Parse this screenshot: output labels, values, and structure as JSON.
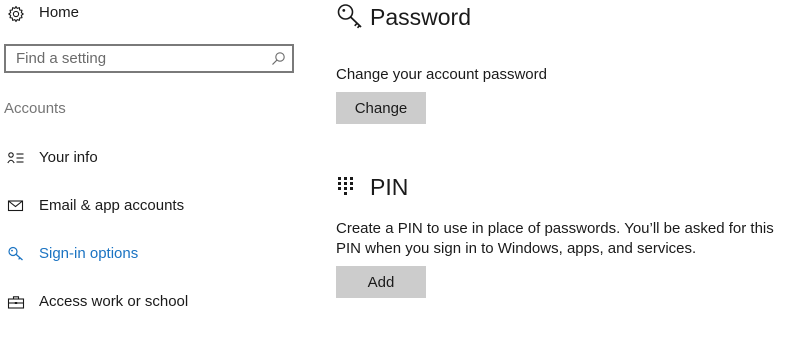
{
  "sidebar": {
    "home": {
      "label": "Home",
      "icon": "gear-icon"
    },
    "search": {
      "placeholder": "Find a setting",
      "value": "",
      "icon": "search-icon"
    },
    "section_title": "Accounts",
    "items": [
      {
        "label": "Your info",
        "icon": "person-card-icon",
        "active": false
      },
      {
        "label": "Email & app accounts",
        "icon": "mail-icon",
        "active": false
      },
      {
        "label": "Sign-in options",
        "icon": "key-icon",
        "active": true
      },
      {
        "label": "Access work or school",
        "icon": "briefcase-icon",
        "active": false
      }
    ]
  },
  "main": {
    "password": {
      "title": "Password",
      "icon": "key-icon",
      "description": "Change your account password",
      "button_label": "Change"
    },
    "pin": {
      "title": "PIN",
      "icon": "dialpad-icon",
      "description_line1": "Create a PIN to use in place of passwords. You’ll be asked for this",
      "description_line2": "PIN when you sign in to Windows, apps, and services.",
      "button_label": "Add"
    }
  },
  "colors": {
    "accent": "#1a73c2",
    "button_bg": "#cccccc",
    "section_title": "#767676",
    "text": "#1a1a1a"
  }
}
